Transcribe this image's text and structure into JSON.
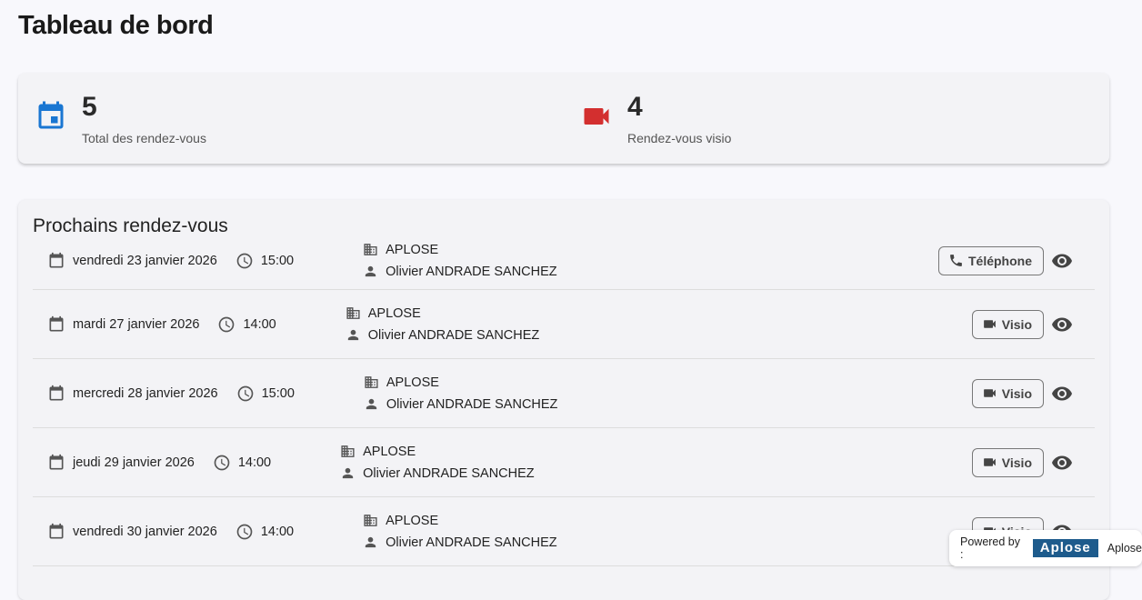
{
  "title": "Tableau de bord",
  "stats": [
    {
      "value": "5",
      "label": "Total des rendez-vous",
      "icon": "calendar-icon",
      "color": "#1976d2"
    },
    {
      "value": "4",
      "label": "Rendez-vous visio",
      "icon": "videocam-icon",
      "color": "#d32f2f"
    }
  ],
  "list": {
    "title": "Prochains rendez-vous",
    "rows": [
      {
        "date": "vendredi 23 janvier 2026",
        "time": "15:00",
        "company": "APLOSE",
        "person": "Olivier ANDRADE SANCHEZ",
        "type": "Téléphone",
        "type_icon": "phone-icon"
      },
      {
        "date": "mardi 27 janvier 2026",
        "time": "14:00",
        "company": "APLOSE",
        "person": "Olivier ANDRADE SANCHEZ",
        "type": "Visio",
        "type_icon": "videocam-icon"
      },
      {
        "date": "mercredi 28 janvier 2026",
        "time": "15:00",
        "company": "APLOSE",
        "person": "Olivier ANDRADE SANCHEZ",
        "type": "Visio",
        "type_icon": "videocam-icon"
      },
      {
        "date": "jeudi 29 janvier 2026",
        "time": "14:00",
        "company": "APLOSE",
        "person": "Olivier ANDRADE SANCHEZ",
        "type": "Visio",
        "type_icon": "videocam-icon"
      },
      {
        "date": "vendredi 30 janvier 2026",
        "time": "14:00",
        "company": "APLOSE",
        "person": "Olivier ANDRADE SANCHEZ",
        "type": "Visio",
        "type_icon": "videocam-icon"
      }
    ]
  },
  "powered": {
    "label": "Powered by :",
    "logo": "Aplose",
    "name": "Aplose"
  }
}
